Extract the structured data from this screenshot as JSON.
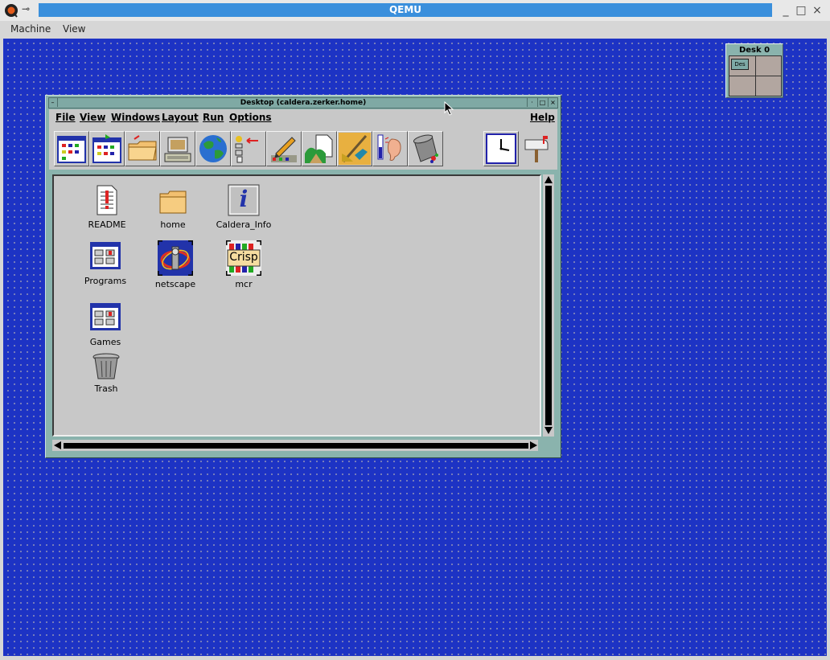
{
  "host": {
    "title": "QEMU",
    "menu": [
      "Machine",
      "View"
    ],
    "pin_glyph": "⊸",
    "controls": [
      "_",
      "□",
      "×"
    ]
  },
  "pager": {
    "title": "Desk 0",
    "mini_label": "Des"
  },
  "desktop_window": {
    "title": "Desktop (caldera.zerker.home)",
    "title_controls": [
      "·",
      "□",
      "×"
    ],
    "menu": {
      "file": "File",
      "view": "View",
      "windows": "Windows",
      "layout": "Layout",
      "run": "Run",
      "options": "Options",
      "help": "Help"
    },
    "toolbar": [
      "program-manager-icon",
      "program-manager-2-icon",
      "folder-icon",
      "computer-icon",
      "globe-icon",
      "system-tools-icon",
      "editor-icon",
      "file-viewer-icon",
      "paint-icon",
      "audio-icon",
      "trash-can-icon",
      "clock-icon",
      "mailbox-icon"
    ],
    "icons": [
      {
        "label": "README",
        "icon": "document-icon"
      },
      {
        "label": "home",
        "icon": "folder-icon"
      },
      {
        "label": "Caldera_Info",
        "icon": "info-icon"
      },
      {
        "label": "Programs",
        "icon": "program-group-icon"
      },
      {
        "label": "netscape",
        "icon": "netscape-icon"
      },
      {
        "label": "mcr",
        "icon": "crisp-icon"
      },
      {
        "label": "Games",
        "icon": "program-group-icon"
      },
      {
        "label": "Trash",
        "icon": "trash-icon"
      }
    ],
    "crisp_text": "Crisp",
    "info_glyph": "i"
  },
  "colors": {
    "desktop_bg": "#1d33c4",
    "window_frame": "#8ab3ad",
    "host_title": "#3a8fdc"
  }
}
